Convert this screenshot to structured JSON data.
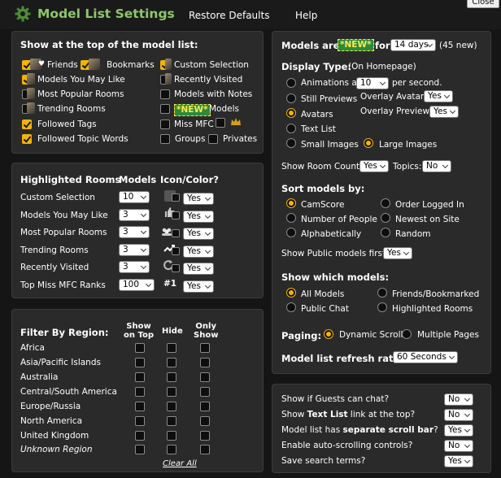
{
  "header": {
    "title": "Model List Settings",
    "menu": [
      "Restore Defaults",
      "Help"
    ],
    "close_label": "Close"
  },
  "top_panel": {
    "title": "Show at the top of the model list:",
    "items": [
      {
        "label": "Friends",
        "checked": true
      },
      {
        "label": "Bookmarks",
        "checked": true
      },
      {
        "label": "Custom Selection",
        "checked": true
      },
      {
        "label": "Models You May Like",
        "checked": true
      },
      {
        "label": "Recently Visited",
        "checked": false
      },
      {
        "label": "Most Popular Rooms",
        "checked": false
      },
      {
        "label": "Models with Notes",
        "checked": false
      },
      {
        "label": "Trending Rooms",
        "checked": false
      },
      {
        "label": "*NEW*",
        "checked": false
      },
      {
        "label": "Models",
        "checked": false
      },
      {
        "label": "Followed Tags",
        "checked": true
      },
      {
        "label": "Miss MFC",
        "checked": false
      },
      {
        "label": "Followed Topic Words",
        "checked": true
      },
      {
        "label": "Groups",
        "checked": false
      },
      {
        "label": "Privates",
        "checked": false
      }
    ]
  },
  "highlighted": {
    "headers": [
      "Highlighted Rooms",
      "Models",
      "Icon/Color?"
    ],
    "rows": [
      {
        "label": "Custom Selection",
        "models": "10",
        "icon": "custom-selection-icon",
        "enabled": "Yes"
      },
      {
        "label": "Models You May Like",
        "models": "3",
        "icon": "thumbs-up-icon",
        "enabled": "Yes"
      },
      {
        "label": "Most Popular Rooms",
        "models": "3",
        "icon": "popular-rooms-icon",
        "enabled": "Yes"
      },
      {
        "label": "Trending Rooms",
        "models": "3",
        "icon": "trending-icon",
        "enabled": "Yes"
      },
      {
        "label": "Recently Visited",
        "models": "3",
        "icon": "recently-visited-icon",
        "enabled": "Yes"
      },
      {
        "label": "Top Miss MFC Ranks",
        "models": "100",
        "icon_text": "#1",
        "enabled": "Yes"
      }
    ]
  },
  "region": {
    "title": "Filter By Region:",
    "col_headers": [
      "Show\non Top",
      "Hide",
      "Only\nShow"
    ],
    "regions": [
      "Africa",
      "Asia/Pacific Islands",
      "Australia",
      "Central/South America",
      "Europe/Russia",
      "North America",
      "United Kingdom",
      "Unknown Region"
    ],
    "clear_all": "Clear All"
  },
  "right_panel": {
    "models_are_label": "Models are",
    "new_badge": "*NEW*",
    "for_label": "for",
    "days_value": "14 days",
    "new_count": "(45 new)",
    "display_type_label": "Display Type:",
    "display_type_sub": "(On Homepage)",
    "animations_label": "Animations at",
    "animations_value": "10",
    "per_second": "per second.",
    "still_previews": "Still Previews",
    "overlay_avatar_label": "Overlay Avatar:",
    "overlay_avatar_value": "Yes",
    "avatars": "Avatars",
    "overlay_preview_label": "Overlay Preview:",
    "overlay_preview_value": "Yes",
    "text_list": "Text List",
    "small_images": "Small Images",
    "large_images": "Large Images",
    "room_count_label": "Show Room Count:",
    "room_count_value": "Yes",
    "topics_label": "Topics:",
    "topics_value": "No",
    "sort_label": "Sort models by:",
    "sort_options": [
      "CamScore",
      "Order Logged In",
      "Number of People",
      "Newest on Site",
      "Alphabetically",
      "Random"
    ],
    "public_first_label": "Show Public models first?",
    "public_first_value": "Yes",
    "which_label": "Show which models:",
    "which_options": [
      "All Models",
      "Friends/Bookmarked",
      "Public Chat",
      "Highlighted Rooms"
    ],
    "paging_label": "Paging:",
    "paging_options": [
      "Dynamic Scroll",
      "Multiple Pages"
    ],
    "refresh_label": "Model list refresh rate:",
    "refresh_value": "60 Seconds"
  },
  "bottom_right": {
    "rows": [
      {
        "pre": "Show if Guests can chat?",
        "bold": "",
        "post": "",
        "value": "No"
      },
      {
        "pre": "Show ",
        "bold": "Text List",
        "post": " link at the top?",
        "value": "No"
      },
      {
        "pre": "Model list has ",
        "bold": "separate scroll bar",
        "post": "?",
        "value": "Yes"
      },
      {
        "pre": "Enable auto-scrolling controls?",
        "bold": "",
        "post": "",
        "value": "No"
      },
      {
        "pre": "Save search terms?",
        "bold": "",
        "post": "",
        "value": "Yes"
      }
    ]
  },
  "colors": {
    "accent": "#f4b400",
    "title_green": "#8ec76a",
    "panel_bg": "#2a2a2a"
  }
}
